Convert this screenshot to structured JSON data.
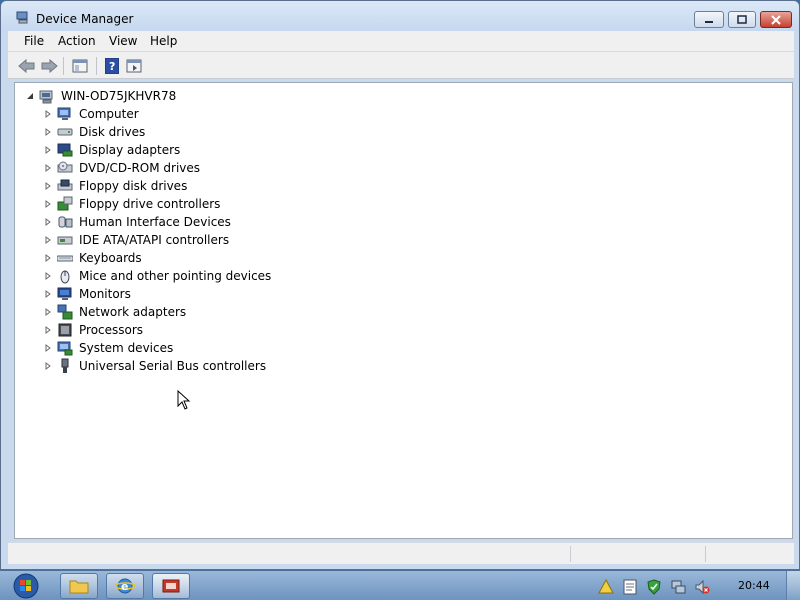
{
  "window": {
    "title": "Device Manager"
  },
  "menu": {
    "file": "File",
    "action": "Action",
    "view": "View",
    "help": "Help"
  },
  "tree": {
    "root": "WIN-OD75JKHVR78",
    "items": [
      {
        "label": "Computer",
        "icon": "computer-icon"
      },
      {
        "label": "Disk drives",
        "icon": "disk-drive-icon"
      },
      {
        "label": "Display adapters",
        "icon": "display-adapter-icon"
      },
      {
        "label": "DVD/CD-ROM drives",
        "icon": "dvd-drive-icon"
      },
      {
        "label": "Floppy disk drives",
        "icon": "floppy-drive-icon"
      },
      {
        "label": "Floppy drive controllers",
        "icon": "floppy-controller-icon"
      },
      {
        "label": "Human Interface Devices",
        "icon": "hid-icon"
      },
      {
        "label": "IDE ATA/ATAPI controllers",
        "icon": "ide-controller-icon"
      },
      {
        "label": "Keyboards",
        "icon": "keyboard-icon"
      },
      {
        "label": "Mice and other pointing devices",
        "icon": "mouse-icon"
      },
      {
        "label": "Monitors",
        "icon": "monitor-icon"
      },
      {
        "label": "Network adapters",
        "icon": "network-adapter-icon"
      },
      {
        "label": "Processors",
        "icon": "processor-icon"
      },
      {
        "label": "System devices",
        "icon": "system-devices-icon"
      },
      {
        "label": "Universal Serial Bus controllers",
        "icon": "usb-icon"
      }
    ]
  },
  "taskbar": {
    "clock": "20:44"
  },
  "colors": {
    "accent": "#3a6ea5",
    "close_red": "#c4412f"
  }
}
